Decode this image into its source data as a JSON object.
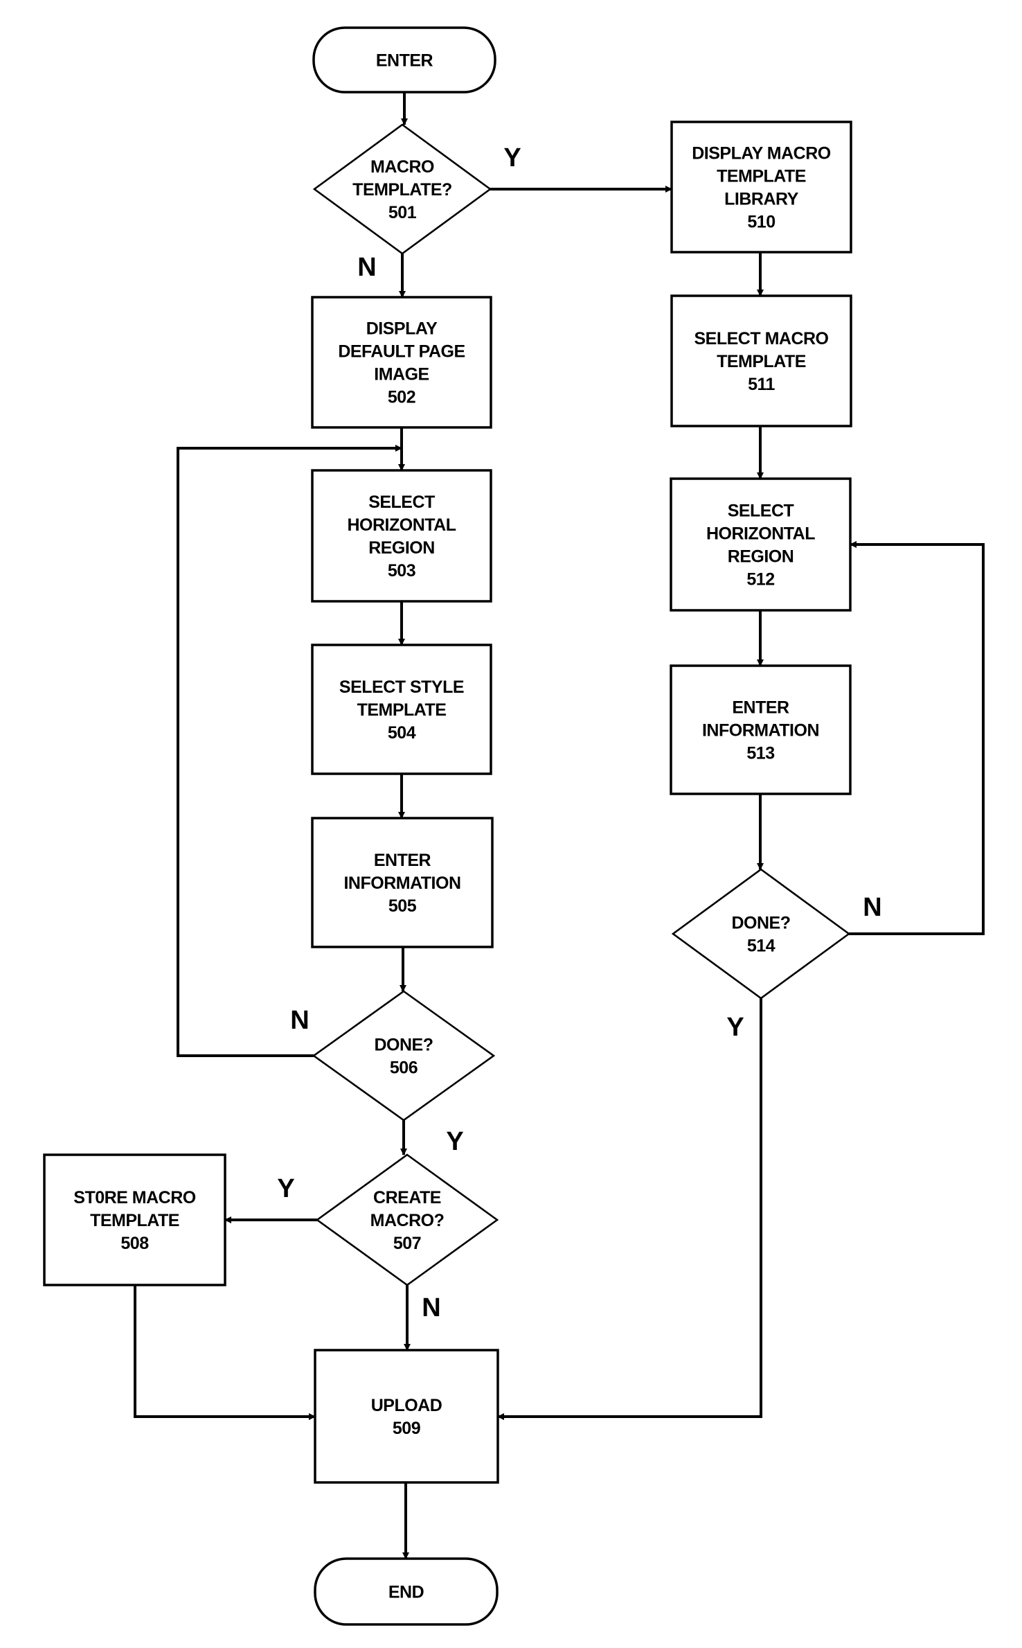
{
  "figure": {
    "type": "flowchart",
    "nodes": [
      {
        "id": "enter",
        "shape": "terminal",
        "lines": [
          "ENTER"
        ]
      },
      {
        "id": "501",
        "shape": "decision",
        "lines": [
          "MACRO",
          "TEMPLATE?",
          "501"
        ]
      },
      {
        "id": "502",
        "shape": "process",
        "lines": [
          "DISPLAY",
          "DEFAULT PAGE",
          "IMAGE",
          "502"
        ]
      },
      {
        "id": "503",
        "shape": "process",
        "lines": [
          "SELECT",
          "HORIZONTAL",
          "REGION",
          "503"
        ]
      },
      {
        "id": "504",
        "shape": "process",
        "lines": [
          "SELECT STYLE",
          "TEMPLATE",
          "504"
        ]
      },
      {
        "id": "505",
        "shape": "process",
        "lines": [
          "ENTER",
          "INFORMATION",
          "505"
        ]
      },
      {
        "id": "506",
        "shape": "decision",
        "lines": [
          "DONE?",
          "506"
        ]
      },
      {
        "id": "507",
        "shape": "decision",
        "lines": [
          "CREATE",
          "MACRO?",
          "507"
        ]
      },
      {
        "id": "508",
        "shape": "process",
        "lines": [
          "ST0RE MACRO",
          "TEMPLATE",
          "508"
        ]
      },
      {
        "id": "509",
        "shape": "process",
        "lines": [
          "UPLOAD",
          "509"
        ]
      },
      {
        "id": "end",
        "shape": "terminal",
        "lines": [
          "END"
        ]
      },
      {
        "id": "510",
        "shape": "process",
        "lines": [
          "DISPLAY MACRO",
          "TEMPLATE",
          "LIBRARY",
          "510"
        ]
      },
      {
        "id": "511",
        "shape": "process",
        "lines": [
          "SELECT MACRO",
          "TEMPLATE",
          "511"
        ]
      },
      {
        "id": "512",
        "shape": "process",
        "lines": [
          "SELECT",
          "HORIZONTAL",
          "REGION",
          "512"
        ]
      },
      {
        "id": "513",
        "shape": "process",
        "lines": [
          "ENTER",
          "INFORMATION",
          "513"
        ]
      },
      {
        "id": "514",
        "shape": "decision",
        "lines": [
          "DONE?",
          "514"
        ]
      }
    ],
    "edges": [
      {
        "from": "enter",
        "to": "501",
        "label": ""
      },
      {
        "from": "501",
        "to": "510",
        "label": "Y"
      },
      {
        "from": "501",
        "to": "502",
        "label": "N"
      },
      {
        "from": "502",
        "to": "503",
        "label": ""
      },
      {
        "from": "503",
        "to": "504",
        "label": ""
      },
      {
        "from": "504",
        "to": "505",
        "label": ""
      },
      {
        "from": "505",
        "to": "506",
        "label": ""
      },
      {
        "from": "506",
        "to": "503",
        "label": "N"
      },
      {
        "from": "506",
        "to": "507",
        "label": "Y"
      },
      {
        "from": "507",
        "to": "508",
        "label": "Y"
      },
      {
        "from": "507",
        "to": "509",
        "label": "N"
      },
      {
        "from": "508",
        "to": "509",
        "label": ""
      },
      {
        "from": "509",
        "to": "end",
        "label": ""
      },
      {
        "from": "510",
        "to": "511",
        "label": ""
      },
      {
        "from": "511",
        "to": "512",
        "label": ""
      },
      {
        "from": "512",
        "to": "513",
        "label": ""
      },
      {
        "from": "513",
        "to": "514",
        "label": ""
      },
      {
        "from": "514",
        "to": "512",
        "label": "N"
      },
      {
        "from": "514",
        "to": "509",
        "label": "Y"
      }
    ]
  }
}
